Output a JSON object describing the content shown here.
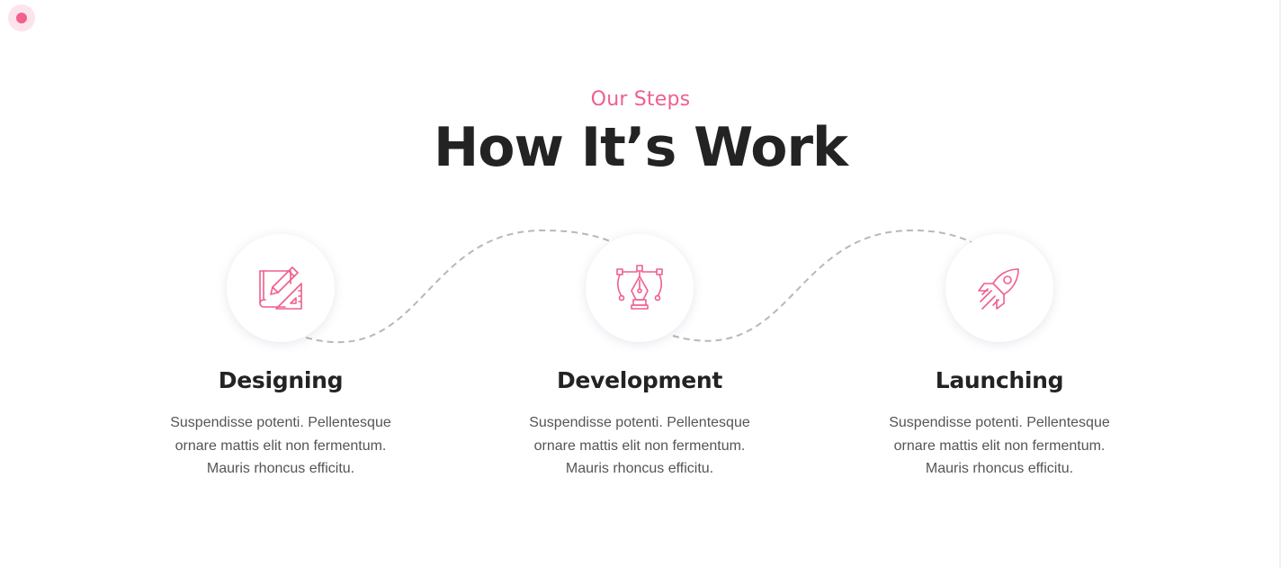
{
  "header": {
    "subtitle": "Our Steps",
    "title": "How It’s Work"
  },
  "steps": [
    {
      "icon": "blueprint-ruler-pencil-icon",
      "title": "Designing",
      "lines": [
        "Suspendisse potenti. Pellentesque",
        "ornare mattis elit non fermentum.",
        "Mauris rhoncus efficitu."
      ]
    },
    {
      "icon": "pen-tool-bezier-icon",
      "title": "Development",
      "lines": [
        "Suspendisse potenti. Pellentesque",
        "ornare mattis elit non fermentum.",
        "Mauris rhoncus efficitu."
      ]
    },
    {
      "icon": "rocket-icon",
      "title": "Launching",
      "lines": [
        "Suspendisse potenti. Pellentesque",
        "ornare mattis elit non fermentum.",
        "Mauris rhoncus efficitu."
      ]
    }
  ],
  "colors": {
    "accent": "#ef5f8c",
    "heading": "#232323",
    "body_text": "#555555",
    "dashed_line": "#b8b8b8"
  }
}
